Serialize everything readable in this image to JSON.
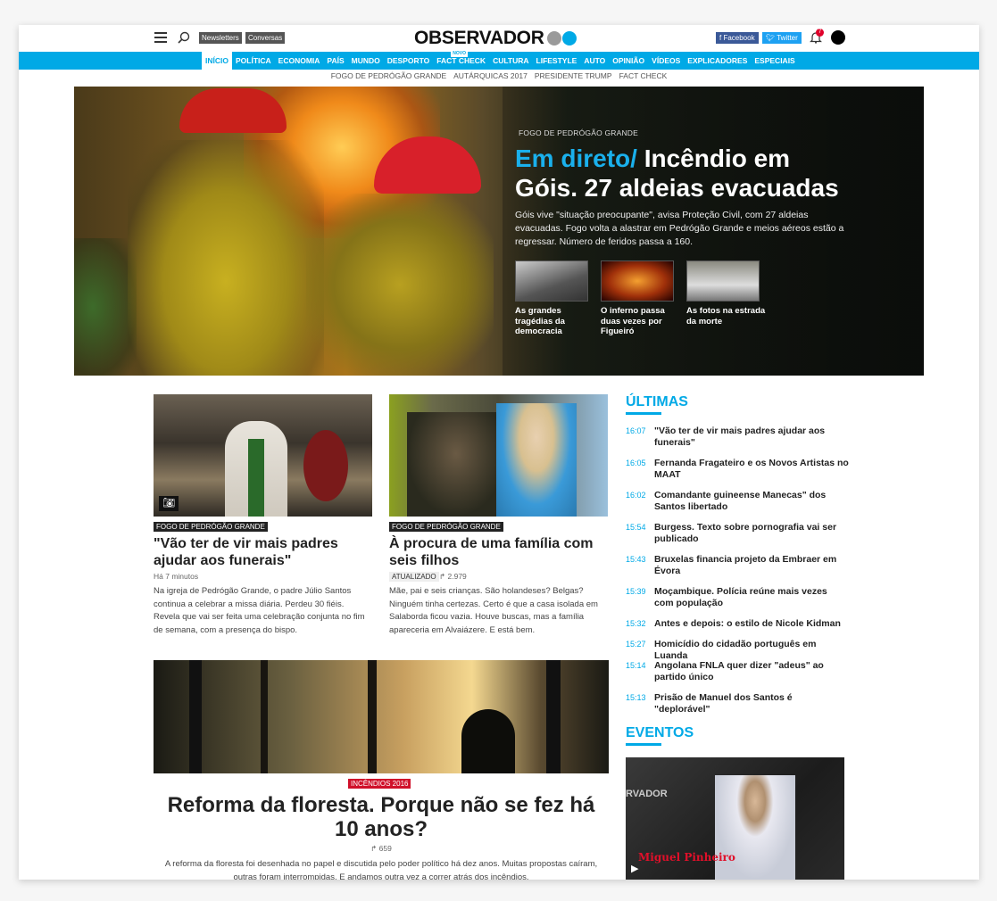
{
  "header": {
    "newsletters": "Newsletters",
    "conversas": "Conversas",
    "logo": "OBSERVADOR",
    "logo_dot_colors": [
      "#9a9a9a",
      "#00a9e6"
    ],
    "facebook": "f Facebook",
    "twitter": "Twitter",
    "notifications": "7"
  },
  "nav": {
    "items": [
      "INÍCIO",
      "POLÍTICA",
      "ECONOMIA",
      "PAÍS",
      "MUNDO",
      "DESPORTO",
      "FACT CHECK",
      "CULTURA",
      "LIFESTYLE",
      "AUTO",
      "OPINIÃO",
      "VÍDEOS",
      "EXPLICADORES",
      "ESPECIAIS"
    ],
    "new_badge": "NOVO"
  },
  "subnav": [
    "FOGO DE PEDRÓGÃO GRANDE",
    "AUTÁRQUICAS 2017",
    "PRESIDENTE TRUMP",
    "FACT CHECK"
  ],
  "hero": {
    "tag": "FOGO DE PEDRÓGÃO GRANDE",
    "live": "Em direto/",
    "title": " Incêndio em Góis. 27 aldeias evacuadas",
    "lead": "Góis vive \"situação preocupante\", avisa Proteção Civil, com 27 aldeias evacuadas. Fogo volta a alastrar em Pedrógão Grande e meios aéreos estão a regressar. Número de feridos passa a 160.",
    "related": [
      "As grandes tragédias da democracia",
      "O inferno passa duas vezes por Figueiró",
      "As fotos na estrada da morte"
    ]
  },
  "article1": {
    "tag": "FOGO DE PEDRÓGÃO GRANDE",
    "title": "\"Vão ter de vir mais padres ajudar aos funerais\"",
    "time": "Há 7 minutos",
    "lead": "Na igreja de Pedrógão Grande, o padre Júlio Santos continua a celebrar a missa diária. Perdeu 30 fiéis. Revela que vai ser feita uma celebração conjunta no fim de semana, com a presença do bispo."
  },
  "article2": {
    "tag": "FOGO DE PEDRÓGÃO GRANDE",
    "title": "À procura de uma família com seis filhos",
    "updated": "ATUALIZADO",
    "shares": "2.979",
    "lead": "Mãe, pai e seis crianças. São holandeses? Belgas? Ninguém tinha certezas. Certo é que a casa isolada em Salaborda ficou vazia. Houve buscas, mas a família apareceria em Alvaiázere. E está bem."
  },
  "article3": {
    "tag": "INCÊNDIOS 2016",
    "tag_color": "#d0102a",
    "title": "Reforma da floresta. Porque não se fez há 10 anos?",
    "shares": "659",
    "lead": "A reforma da floresta foi desenhada no papel e discutida pelo poder político há dez anos. Muitas propostas caíram, outras foram interrompidas. E andamos outra vez a correr atrás dos incêndios."
  },
  "latest": {
    "title": "ÚLTIMAS",
    "items": [
      {
        "time": "16:07",
        "text": "\"Vão ter de vir mais padres ajudar aos funerais\""
      },
      {
        "time": "16:05",
        "text": "Fernanda Fragateiro e os Novos Artistas no MAAT"
      },
      {
        "time": "16:02",
        "text": "Comandante guineense Manecas\" dos Santos libertado"
      },
      {
        "time": "15:54",
        "text": "Burgess. Texto sobre pornografia vai ser publicado"
      },
      {
        "time": "15:43",
        "text": "Bruxelas financia projeto da Embraer em Évora"
      },
      {
        "time": "15:39",
        "text": "Moçambique. Polícia reúne mais vezes com população"
      },
      {
        "time": "15:32",
        "text": "Antes e depois: o estilo de Nicole Kidman"
      },
      {
        "time": "15:27",
        "text": "Homicídio do cidadão português em Luanda"
      },
      {
        "time": "15:14",
        "text": "Angolana FNLA quer dizer \"adeus\" ao partido único"
      },
      {
        "time": "15:13",
        "text": "Prisão de Manuel dos Santos é \"deplorável\""
      }
    ]
  },
  "events": {
    "title": "EVENTOS",
    "video_logo": "RVADOR",
    "video_caption": "Miguel Pinheiro"
  },
  "colors": {
    "accent": "#00a9e6",
    "facebook": "#3b5998",
    "twitter": "#1da1f2"
  }
}
